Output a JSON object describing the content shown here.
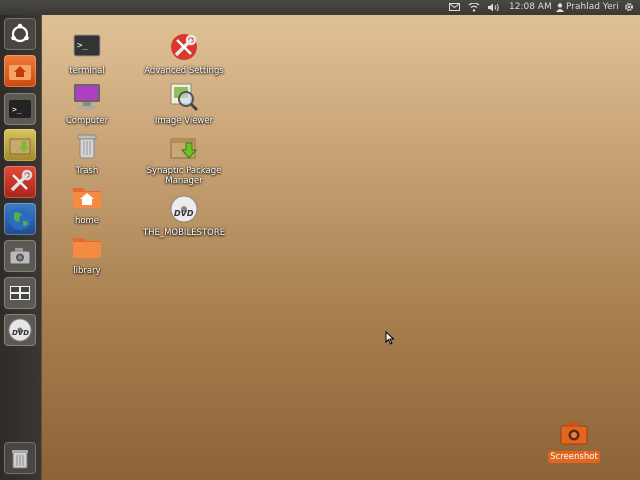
{
  "topbar": {
    "time": "12:08 AM",
    "user": "Prahlad Yeri",
    "indicators": [
      "mail-icon",
      "network-icon",
      "volume-icon",
      "user-icon",
      "gear-icon"
    ]
  },
  "launcher": {
    "items": [
      {
        "name": "ubuntu-logo-icon"
      },
      {
        "name": "home-folder-icon"
      },
      {
        "name": "terminal-icon"
      },
      {
        "name": "synaptic-package-icon"
      },
      {
        "name": "advanced-settings-icon"
      },
      {
        "name": "firefox-globe-icon"
      },
      {
        "name": "screenshot-camera-icon"
      },
      {
        "name": "workspace-switcher-icon"
      },
      {
        "name": "dvd-icon"
      }
    ],
    "trash": {
      "name": "trash-icon"
    }
  },
  "desktop": {
    "icons": [
      {
        "label": "terminal",
        "icon": "terminal-icon"
      },
      {
        "label": "Computer",
        "icon": "computer-icon"
      },
      {
        "label": "Trash",
        "icon": "trash-icon"
      },
      {
        "label": "home",
        "icon": "home-folder-icon"
      },
      {
        "label": "library",
        "icon": "folder-icon"
      },
      {
        "label": "Advanced Settings",
        "icon": "advanced-settings-icon"
      },
      {
        "label": "Image Viewer",
        "icon": "image-viewer-icon"
      },
      {
        "label": "Synaptic Package Manager",
        "icon": "synaptic-package-icon"
      },
      {
        "label": "THE_MOBILESTORE",
        "icon": "dvd-icon"
      },
      {
        "label": "Screenshot",
        "icon": "screenshot-camera-icon"
      }
    ]
  },
  "colors": {
    "accent": "#e2661e",
    "panel": "#3c3b37",
    "launcher": "#35302b"
  }
}
